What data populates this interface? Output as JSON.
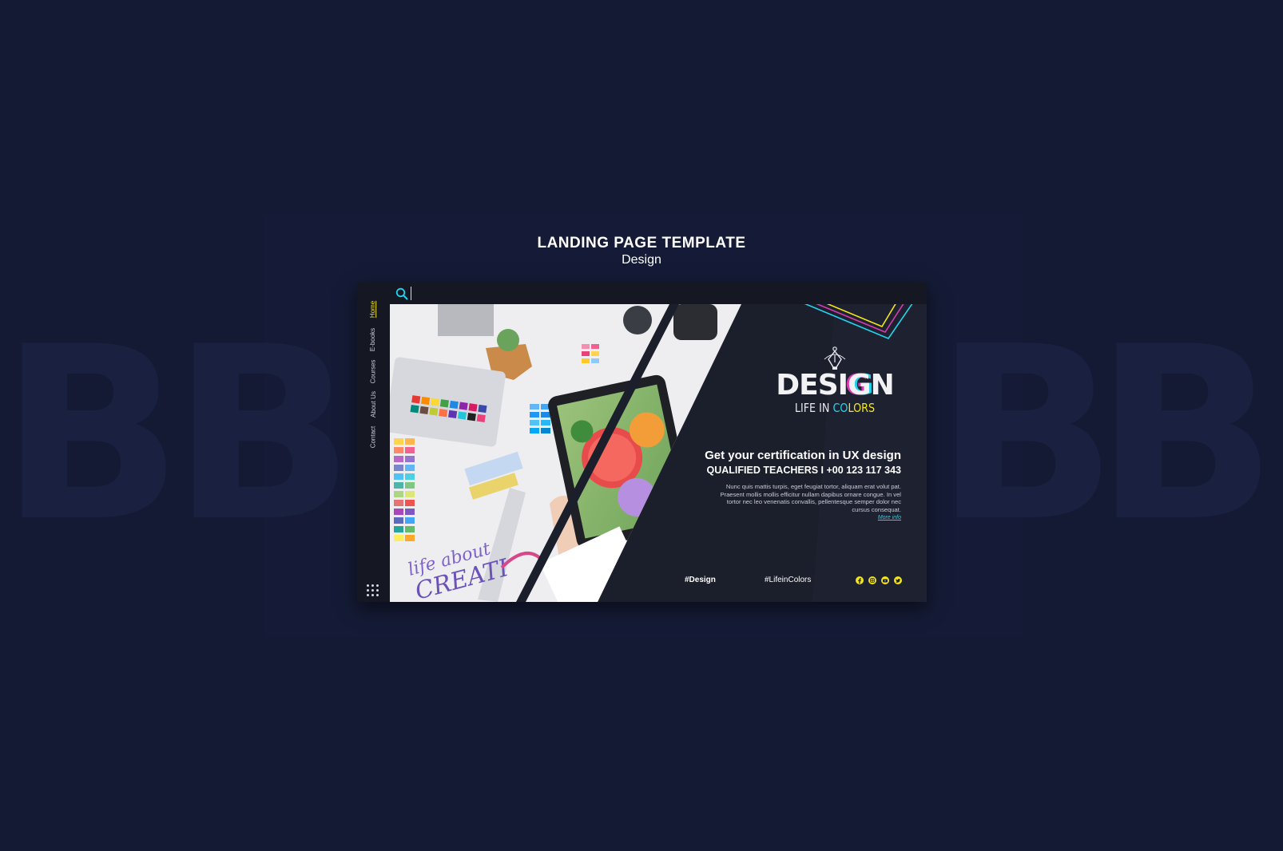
{
  "header": {
    "title": "LANDING PAGE TEMPLATE",
    "subtitle": "Design"
  },
  "sidebar": {
    "items": [
      {
        "label": "Home",
        "active": true
      },
      {
        "label": "E-books",
        "active": false
      },
      {
        "label": "Courses",
        "active": false
      },
      {
        "label": "About Us",
        "active": false
      },
      {
        "label": "Contact",
        "active": false
      }
    ],
    "menu_icon": "grid-dots-icon"
  },
  "search": {
    "value": "",
    "icon": "search-icon"
  },
  "brand": {
    "logo_icon": "pen-nib-icon",
    "title_part1": "DESI",
    "title_part2": "G",
    "title_part3": "N",
    "subtitle_prefix": "LIFE IN ",
    "subtitle_colored": [
      "C",
      "O",
      "L",
      "O",
      "R",
      "S"
    ]
  },
  "hero": {
    "headline": "Get your certification in UX design",
    "subheadline": "QUALIFIED TEACHERS  I  +00 123 117 343",
    "body": "Nunc quis mattis turpis, eget feugiat tortor, aliquam erat volut pat. Praesent mollis mollis efficitur nullam dapibus ornare congue. In vel tortor nec leo venenatis convallis, pellentesque semper dolor nec cursus consequat.",
    "more_link": "More info"
  },
  "footer": {
    "hashtag1": "#Design",
    "hashtag2": "#LifeinColors",
    "socials": [
      "facebook-icon",
      "instagram-icon",
      "youtube-icon",
      "twitter-icon"
    ]
  },
  "colors": {
    "background": "#141a34",
    "panel": "#1b1e2b",
    "accent_yellow": "#f3e51a",
    "accent_cyan": "#22d3ee",
    "accent_magenta": "#d63cb0"
  }
}
